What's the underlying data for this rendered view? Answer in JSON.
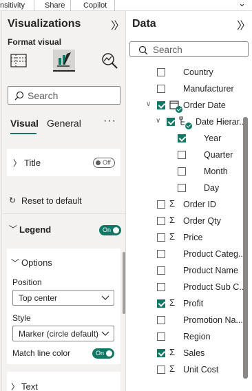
{
  "ribbon": {
    "items": [
      "nsitivity",
      "Share",
      "Copilot"
    ]
  },
  "viz": {
    "title": "Visualizations",
    "format_label": "Format visual",
    "search_placeholder": "Search",
    "tabs": [
      "Visual",
      "General"
    ],
    "more": "···",
    "title_section": {
      "label": "Title",
      "toggle": "Off"
    },
    "reset_label": "Reset to default",
    "legend": {
      "label": "Legend",
      "toggle": "On"
    },
    "options": {
      "label": "Options",
      "position_label": "Position",
      "position_value": "Top center",
      "style_label": "Style",
      "style_value": "Marker (circle default)",
      "match_label": "Match line color",
      "match_toggle": "On"
    },
    "text_section": {
      "label": "Text"
    }
  },
  "data_pane": {
    "title": "Data",
    "search_placeholder": "Search",
    "fields": [
      {
        "name": "Country",
        "checked": false,
        "sigma": false,
        "indent": 0
      },
      {
        "name": "Manufacturer",
        "checked": false,
        "sigma": false,
        "indent": 0
      },
      {
        "name": "Order Date",
        "checked": true,
        "sigma": false,
        "indent": 0,
        "calendar": true,
        "expanded": true
      },
      {
        "name": "Date Hierar...",
        "checked": true,
        "sigma": false,
        "indent": 1,
        "hierarchy": true,
        "expanded": true
      },
      {
        "name": "Year",
        "checked": true,
        "sigma": false,
        "indent": 2
      },
      {
        "name": "Quarter",
        "checked": false,
        "sigma": false,
        "indent": 2
      },
      {
        "name": "Month",
        "checked": false,
        "sigma": false,
        "indent": 2
      },
      {
        "name": "Day",
        "checked": false,
        "sigma": false,
        "indent": 2
      },
      {
        "name": "Order ID",
        "checked": false,
        "sigma": true,
        "indent": 0
      },
      {
        "name": "Order Qty",
        "checked": false,
        "sigma": true,
        "indent": 0
      },
      {
        "name": "Price",
        "checked": false,
        "sigma": true,
        "indent": 0
      },
      {
        "name": "Product Categ...",
        "checked": false,
        "sigma": false,
        "indent": 0
      },
      {
        "name": "Product Name",
        "checked": false,
        "sigma": false,
        "indent": 0
      },
      {
        "name": "Product Sub C...",
        "checked": false,
        "sigma": false,
        "indent": 0
      },
      {
        "name": "Profit",
        "checked": true,
        "sigma": true,
        "indent": 0
      },
      {
        "name": "Promotion Na...",
        "checked": false,
        "sigma": false,
        "indent": 0
      },
      {
        "name": "Region",
        "checked": false,
        "sigma": false,
        "indent": 0
      },
      {
        "name": "Sales",
        "checked": true,
        "sigma": true,
        "indent": 0
      },
      {
        "name": "Unit Cost",
        "checked": false,
        "sigma": true,
        "indent": 0
      }
    ]
  },
  "colors": {
    "accent": "#117865",
    "pane_bg": "#f3f2f1"
  }
}
